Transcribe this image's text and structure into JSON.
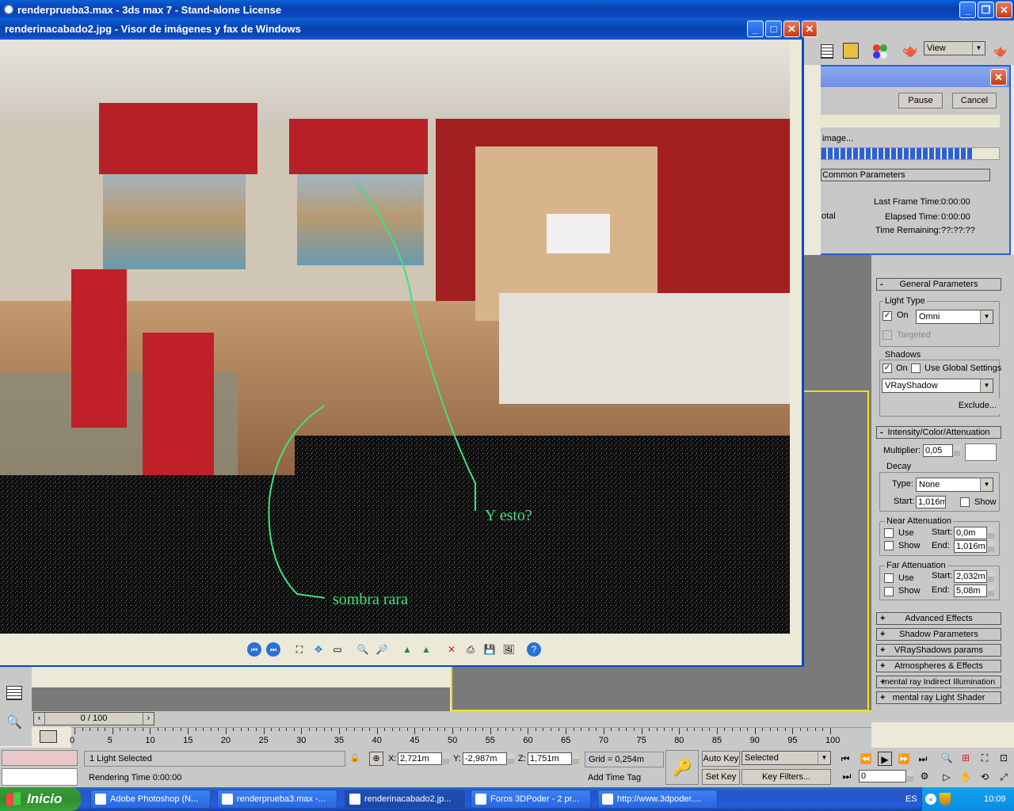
{
  "max_window": {
    "title": "renderprueba3.max - 3ds max 7  - Stand-alone License",
    "view_dropdown": "View"
  },
  "render_dialog": {
    "pause": "Pause",
    "cancel": "Cancel",
    "status_text": "image...",
    "progress": 0.85,
    "section_title": "Common Parameters",
    "total_label": "otal",
    "last_frame_label": "Last Frame Time:",
    "last_frame_value": "0:00:00",
    "elapsed_label": "Elapsed Time:",
    "elapsed_value": "0:00:00",
    "remaining_label": "Time Remaining:",
    "remaining_value": "??:??:??"
  },
  "viewer": {
    "title": "renderinacabado2.jpg - Visor de imágenes y fax de Windows",
    "annotation_1": "Y esto?",
    "annotation_2": "sombra rara"
  },
  "light_panel": {
    "general_title": "General Parameters",
    "light_type_label": "Light Type",
    "on_label": "On",
    "light_type_value": "Omni",
    "targeted_label": "Targeted",
    "shadows_label": "Shadows",
    "shadows_on_label": "On",
    "use_global_label": "Use Global Settings",
    "shadow_type_value": "VRayShadow",
    "exclude_label": "Exclude...",
    "intensity_title": "Intensity/Color/Attenuation",
    "multiplier_label": "Multiplier:",
    "multiplier_value": "0,05",
    "decay_label": "Decay",
    "type_label": "Type:",
    "decay_type_value": "None",
    "start_label": "Start:",
    "decay_start_value": "1,016m",
    "show_label": "Show",
    "near_label": "Near Attenuation",
    "use_label": "Use",
    "near_start_value": "0,0m",
    "end_label": "End:",
    "near_end_value": "1,016m",
    "far_label": "Far Attenuation",
    "far_start_value": "2,032m",
    "far_end_value": "5,08m",
    "rollouts": [
      "Advanced Effects",
      "Shadow Parameters",
      "VRayShadows params",
      "Atmospheres & Effects",
      "mental ray Indirect Illumination",
      "mental ray Light Shader"
    ]
  },
  "timeline": {
    "frame_counter": "0 / 100",
    "ticks": [
      "0",
      "5",
      "10",
      "15",
      "20",
      "25",
      "30",
      "35",
      "40",
      "45",
      "50",
      "55",
      "60",
      "65",
      "70",
      "75",
      "80",
      "85",
      "90",
      "95",
      "100"
    ]
  },
  "status": {
    "selection": "1 Light Selected",
    "rendering_time": "Rendering Time  0:00:00",
    "x_label": "X:",
    "x_value": "2,721m",
    "y_label": "Y:",
    "y_value": "-2,987m",
    "z_label": "Z:",
    "z_value": "1,751m",
    "grid": "Grid = 0,254m",
    "add_time_tag": "Add Time Tag",
    "auto_key": "Auto Key",
    "selected_dropdown": "Selected",
    "set_key": "Set Key",
    "key_filters": "Key Filters...",
    "frame_field": "0"
  },
  "taskbar": {
    "start_label": "Inicio",
    "items": [
      "Adobe Photoshop (N...",
      "renderprueba3.max -...",
      "renderinacabado2.jp...",
      "Foros 3DPoder - 2 pr...",
      "http://www.3dpoder...."
    ],
    "language": "ES",
    "clock": "10:09"
  }
}
